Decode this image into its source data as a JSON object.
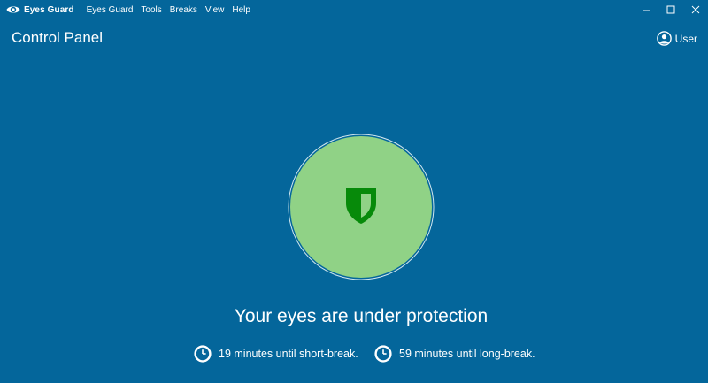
{
  "titlebar": {
    "app_name": "Eyes Guard",
    "menu": [
      "Eyes Guard",
      "Tools",
      "Breaks",
      "View",
      "Help"
    ],
    "controls": [
      "minimize-icon",
      "maximize-icon",
      "close-icon"
    ]
  },
  "header": {
    "title": "Control Panel",
    "user_label": "User"
  },
  "status": {
    "icon": "shield-icon",
    "message": "Your eyes are under protection",
    "circle_color": "#90d286",
    "shield_color": "#078a0a"
  },
  "timers": {
    "short": "19 minutes until short-break.",
    "long": "59 minutes until long-break."
  },
  "colors": {
    "background": "#04669b",
    "text": "#ffffff"
  }
}
